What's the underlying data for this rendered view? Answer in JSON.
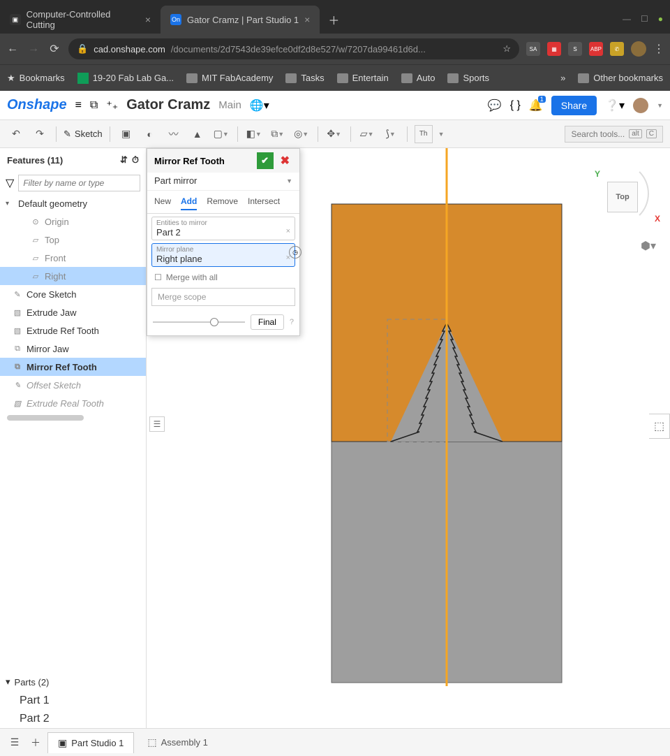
{
  "browser": {
    "tabs": [
      {
        "title": "Computer-Controlled Cutting",
        "active": false
      },
      {
        "title": "Gator Cramz | Part Studio 1",
        "active": true
      }
    ],
    "url_host": "cad.onshape.com",
    "url_path": "/documents/2d7543de39efce0df2d8e527/w/7207da99461d6d...",
    "bookmarks": [
      "Bookmarks",
      "19-20 Fab Lab Ga...",
      "MIT FabAcademy",
      "Tasks",
      "Entertain",
      "Auto",
      "Sports"
    ],
    "other_bookmarks": "Other bookmarks"
  },
  "doc": {
    "logo": "Onshape",
    "title": "Gator Cramz",
    "subtitle": "Main",
    "share": "Share",
    "notif_count": "1"
  },
  "toolbar": {
    "sketch": "Sketch",
    "search_placeholder": "Search tools...",
    "kbd1": "alt",
    "kbd2": "C",
    "th": "Th"
  },
  "features": {
    "header": "Features (11)",
    "filter_placeholder": "Filter by name or type",
    "default_geometry": "Default geometry",
    "items_geo": [
      "Origin",
      "Top",
      "Front",
      "Right"
    ],
    "items": [
      {
        "label": "Core Sketch",
        "ico": "✎"
      },
      {
        "label": "Extrude Jaw",
        "ico": "▧"
      },
      {
        "label": "Extrude Ref Tooth",
        "ico": "▧"
      },
      {
        "label": "Mirror Jaw",
        "ico": "⧉"
      },
      {
        "label": "Mirror Ref Tooth",
        "ico": "⧉",
        "selected": true,
        "bold": true
      },
      {
        "label": "Offset Sketch",
        "ico": "✎",
        "italic": true
      },
      {
        "label": "Extrude Real Tooth",
        "ico": "▧",
        "italic": true
      }
    ],
    "parts_header": "Parts (2)",
    "parts": [
      "Part 1",
      "Part 2"
    ]
  },
  "dialog": {
    "title": "Mirror Ref Tooth",
    "type": "Part mirror",
    "tabs": [
      "New",
      "Add",
      "Remove",
      "Intersect"
    ],
    "active_tab": "Add",
    "entities_label": "Entities to mirror",
    "entities_value": "Part 2",
    "plane_label": "Mirror plane",
    "plane_value": "Right plane",
    "merge_all": "Merge with all",
    "merge_scope": "Merge scope",
    "final": "Final"
  },
  "viewcube": {
    "face": "Top",
    "y": "Y",
    "x": "X"
  },
  "bottom": {
    "tabs": [
      {
        "label": "Part Studio 1",
        "active": true
      },
      {
        "label": "Assembly 1",
        "active": false
      }
    ]
  }
}
